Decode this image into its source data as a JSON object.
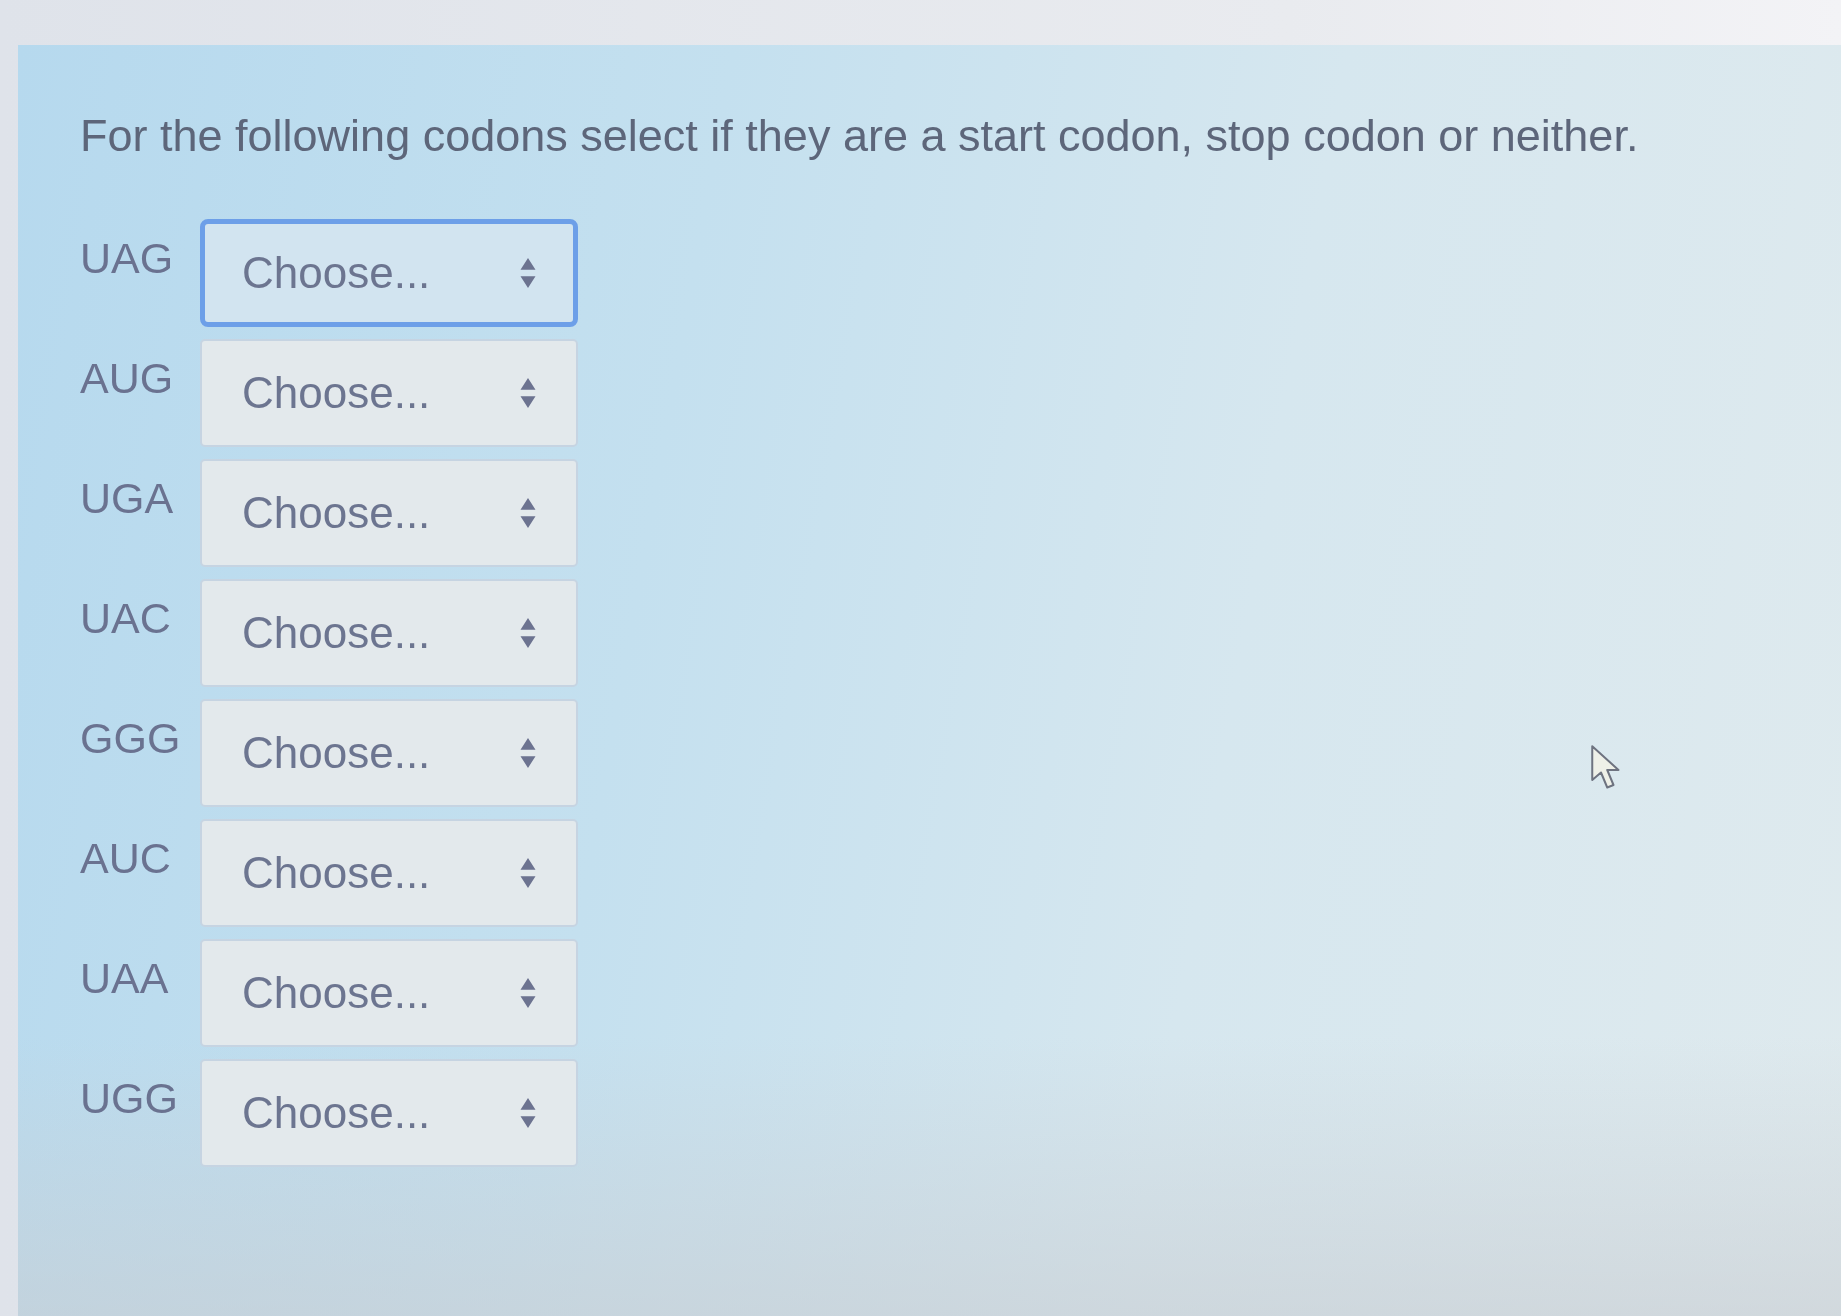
{
  "instruction": "For the following codons select if they are a start codon, stop codon or neither.",
  "questions": [
    {
      "codon": "UAG",
      "selection": "Choose...",
      "focused": true
    },
    {
      "codon": "AUG",
      "selection": "Choose...",
      "focused": false
    },
    {
      "codon": "UGA",
      "selection": "Choose...",
      "focused": false
    },
    {
      "codon": "UAC",
      "selection": "Choose...",
      "focused": false
    },
    {
      "codon": "GGG",
      "selection": "Choose...",
      "focused": false
    },
    {
      "codon": "AUC",
      "selection": "Choose...",
      "focused": false
    },
    {
      "codon": "UAA",
      "selection": "Choose...",
      "focused": false
    },
    {
      "codon": "UGG",
      "selection": "Choose...",
      "focused": false
    }
  ]
}
